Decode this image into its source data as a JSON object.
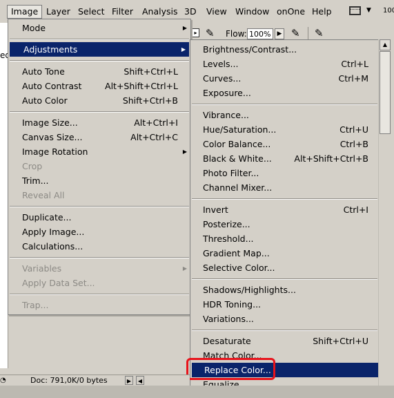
{
  "menubar": {
    "items": [
      "Image",
      "Layer",
      "Select",
      "Filter",
      "Analysis",
      "3D",
      "View",
      "Window",
      "onOne",
      "Help"
    ],
    "zoom": "100"
  },
  "options_bar": {
    "flow_label": "Flow:",
    "flow_value": "100%"
  },
  "left_strip_text": "ed",
  "image_menu": {
    "items": [
      {
        "label": "Mode",
        "shortcut": "",
        "submenu": true,
        "disabled": false
      },
      {
        "label": "Adjustments",
        "shortcut": "",
        "submenu": true,
        "disabled": false,
        "highlighted": true
      },
      {
        "label": "Auto Tone",
        "shortcut": "Shift+Ctrl+L",
        "disabled": false
      },
      {
        "label": "Auto Contrast",
        "shortcut": "Alt+Shift+Ctrl+L",
        "disabled": false
      },
      {
        "label": "Auto Color",
        "shortcut": "Shift+Ctrl+B",
        "disabled": false
      },
      {
        "label": "Image Size...",
        "shortcut": "Alt+Ctrl+I",
        "disabled": false
      },
      {
        "label": "Canvas Size...",
        "shortcut": "Alt+Ctrl+C",
        "disabled": false
      },
      {
        "label": "Image Rotation",
        "shortcut": "",
        "submenu": true,
        "disabled": false
      },
      {
        "label": "Crop",
        "shortcut": "",
        "disabled": true
      },
      {
        "label": "Trim...",
        "shortcut": "",
        "disabled": false
      },
      {
        "label": "Reveal All",
        "shortcut": "",
        "disabled": true
      },
      {
        "label": "Duplicate...",
        "shortcut": "",
        "disabled": false
      },
      {
        "label": "Apply Image...",
        "shortcut": "",
        "disabled": false
      },
      {
        "label": "Calculations...",
        "shortcut": "",
        "disabled": false
      },
      {
        "label": "Variables",
        "shortcut": "",
        "submenu": true,
        "disabled": true
      },
      {
        "label": "Apply Data Set...",
        "shortcut": "",
        "disabled": true
      },
      {
        "label": "Trap...",
        "shortcut": "",
        "disabled": true
      }
    ]
  },
  "adjustments_menu": {
    "items": [
      {
        "label": "Brightness/Contrast...",
        "shortcut": ""
      },
      {
        "label": "Levels...",
        "shortcut": "Ctrl+L"
      },
      {
        "label": "Curves...",
        "shortcut": "Ctrl+M"
      },
      {
        "label": "Exposure...",
        "shortcut": ""
      },
      {
        "label": "Vibrance...",
        "shortcut": ""
      },
      {
        "label": "Hue/Saturation...",
        "shortcut": "Ctrl+U"
      },
      {
        "label": "Color Balance...",
        "shortcut": "Ctrl+B"
      },
      {
        "label": "Black & White...",
        "shortcut": "Alt+Shift+Ctrl+B"
      },
      {
        "label": "Photo Filter...",
        "shortcut": ""
      },
      {
        "label": "Channel Mixer...",
        "shortcut": ""
      },
      {
        "label": "Invert",
        "shortcut": "Ctrl+I"
      },
      {
        "label": "Posterize...",
        "shortcut": ""
      },
      {
        "label": "Threshold...",
        "shortcut": ""
      },
      {
        "label": "Gradient Map...",
        "shortcut": ""
      },
      {
        "label": "Selective Color...",
        "shortcut": ""
      },
      {
        "label": "Shadows/Highlights...",
        "shortcut": ""
      },
      {
        "label": "HDR Toning...",
        "shortcut": ""
      },
      {
        "label": "Variations...",
        "shortcut": ""
      },
      {
        "label": "Desaturate",
        "shortcut": "Shift+Ctrl+U"
      },
      {
        "label": "Match Color...",
        "shortcut": ""
      },
      {
        "label": "Replace Color...",
        "shortcut": "",
        "highlighted": true
      },
      {
        "label": "Equalize",
        "shortcut": ""
      }
    ]
  },
  "statusbar": {
    "doc": "Doc: 791,0K/0 bytes"
  },
  "colors": {
    "menu_bg": "#d4d0c8",
    "highlight_bg": "#0a246a",
    "highlight_text": "#ffffff",
    "disabled_text": "#8c8a85",
    "annotation_box": "#e8121a"
  }
}
